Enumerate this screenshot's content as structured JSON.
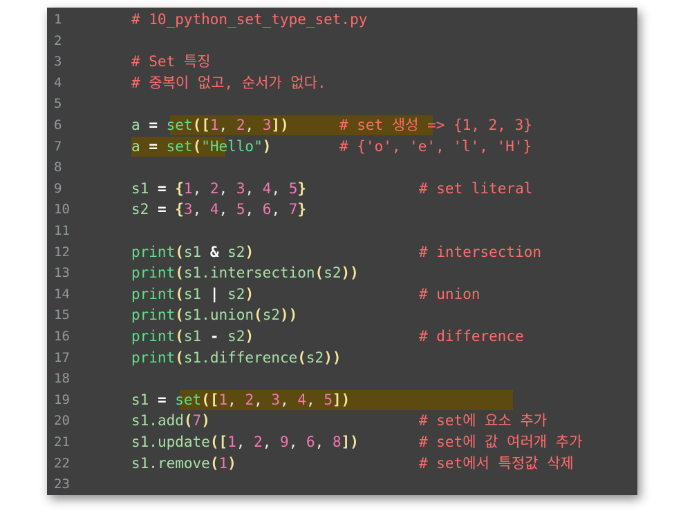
{
  "editor": {
    "lines": [
      {
        "n": "1",
        "code": "# 10_python_set_type_set.py",
        "comment": ""
      },
      {
        "n": "2",
        "code": "",
        "comment": ""
      },
      {
        "n": "3",
        "code": "# Set 특징",
        "comment": ""
      },
      {
        "n": "4",
        "code": "# 중복이 없고, 순서가 없다.",
        "comment": ""
      },
      {
        "n": "5",
        "code": "",
        "comment": ""
      },
      {
        "n": "6",
        "code": "a = set([1, 2, 3])",
        "comment": "# set 생성 => {1, 2, 3}"
      },
      {
        "n": "7",
        "code": "a = set(\"Hello\")",
        "comment": "# {'o', 'e', 'l', 'H'}"
      },
      {
        "n": "8",
        "code": "",
        "comment": ""
      },
      {
        "n": "9",
        "code": "s1 = {1, 2, 3, 4, 5}",
        "comment": "# set literal"
      },
      {
        "n": "10",
        "code": "s2 = {3, 4, 5, 6, 7}",
        "comment": ""
      },
      {
        "n": "11",
        "code": "",
        "comment": ""
      },
      {
        "n": "12",
        "code": "print(s1 & s2)",
        "comment": "# intersection"
      },
      {
        "n": "13",
        "code": "print(s1.intersection(s2))",
        "comment": ""
      },
      {
        "n": "14",
        "code": "print(s1 | s2)",
        "comment": "# union"
      },
      {
        "n": "15",
        "code": "print(s1.union(s2))",
        "comment": ""
      },
      {
        "n": "16",
        "code": "print(s1 - s2)",
        "comment": "# difference"
      },
      {
        "n": "17",
        "code": "print(s1.difference(s2))",
        "comment": ""
      },
      {
        "n": "18",
        "code": "",
        "comment": ""
      },
      {
        "n": "19",
        "code": "s1 = set([1, 2, 3, 4, 5])",
        "comment": ""
      },
      {
        "n": "20",
        "code": "s1.add(7)",
        "comment": "# set에 요소 추가"
      },
      {
        "n": "21",
        "code": "s1.update([1, 2, 9, 6, 8])",
        "comment": "# set에 값 여러개 추가"
      },
      {
        "n": "22",
        "code": "s1.remove(1)",
        "comment": "# set에서 특정값 삭제"
      },
      {
        "n": "23",
        "code": "",
        "comment": ""
      }
    ],
    "colors": {
      "background": "#3f3f3f",
      "comment": "#ff6b6b",
      "function": "#5fe08c",
      "number": "#f478b3",
      "bracket": "#f3e69a",
      "highlight": "#5c4a10"
    }
  }
}
